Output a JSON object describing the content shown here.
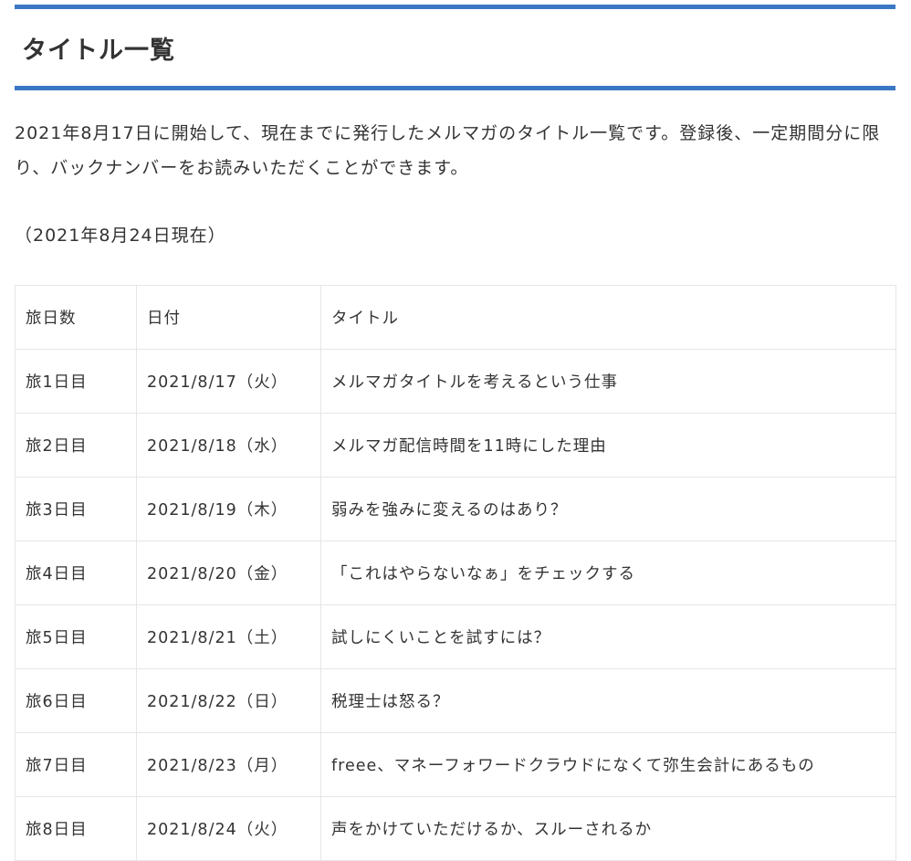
{
  "heading": "タイトル一覧",
  "intro": "2021年8月17日に開始して、現在までに発行したメルマガのタイトル一覧です。登録後、一定期間分に限り、バックナンバーをお読みいただくことができます。",
  "as_of": "（2021年8月24日現在）",
  "table": {
    "headers": [
      "旅日数",
      "日付",
      "タイトル"
    ],
    "rows": [
      {
        "day": "旅1日目",
        "date": "2021/8/17（火）",
        "title": "メルマガタイトルを考えるという仕事"
      },
      {
        "day": "旅2日目",
        "date": "2021/8/18（水）",
        "title": "メルマガ配信時間を11時にした理由"
      },
      {
        "day": "旅3日目",
        "date": "2021/8/19（木）",
        "title": "弱みを強みに変えるのはあり？"
      },
      {
        "day": "旅4日目",
        "date": "2021/8/20（金）",
        "title": "「これはやらないなぁ」をチェックする"
      },
      {
        "day": "旅5日目",
        "date": "2021/8/21（土）",
        "title": "試しにくいことを試すには？"
      },
      {
        "day": "旅6日目",
        "date": "2021/8/22（日）",
        "title": "税理士は怒る？"
      },
      {
        "day": "旅7日目",
        "date": "2021/8/23（月）",
        "title": "freee、マネーフォワードクラウドになくて弥生会計にあるもの"
      },
      {
        "day": "旅8日目",
        "date": "2021/8/24（火）",
        "title": "声をかけていただけるか、スルーされるか"
      }
    ]
  },
  "colors": {
    "accent": "#3b78c3",
    "text": "#333333",
    "table_border": "#e6e6e6"
  }
}
